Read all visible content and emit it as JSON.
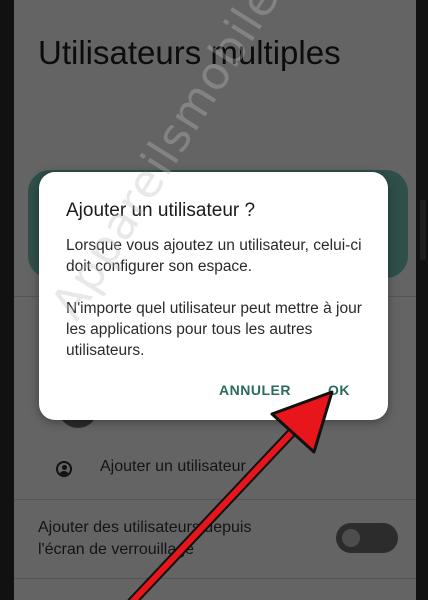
{
  "settings_page": {
    "title": "Utilisateurs multiples",
    "add_user_item": "Ajouter un utilisateur",
    "lockscreen_add_users": "Ajouter des utilisateurs depuis l'écran de verrouillage",
    "lockscreen_toggle_on": false
  },
  "dialog": {
    "title": "Ajouter un utilisateur ?",
    "paragraph_1": "Lorsque vous ajoutez un utilisateur, celui-ci doit configurer son espace.",
    "paragraph_2": "N'importe quel utilisateur peut mettre à jour les applications pour tous les autres utilisateurs.",
    "cancel_label": "ANNULER",
    "ok_label": "OK"
  },
  "watermark": "Appareilsmobiles.fr",
  "colors": {
    "accent": "#2a6b5f",
    "card": "#2f4f4b",
    "annotation_arrow": "#e8161b"
  },
  "icons": {
    "add_user": "account-circle-icon"
  }
}
